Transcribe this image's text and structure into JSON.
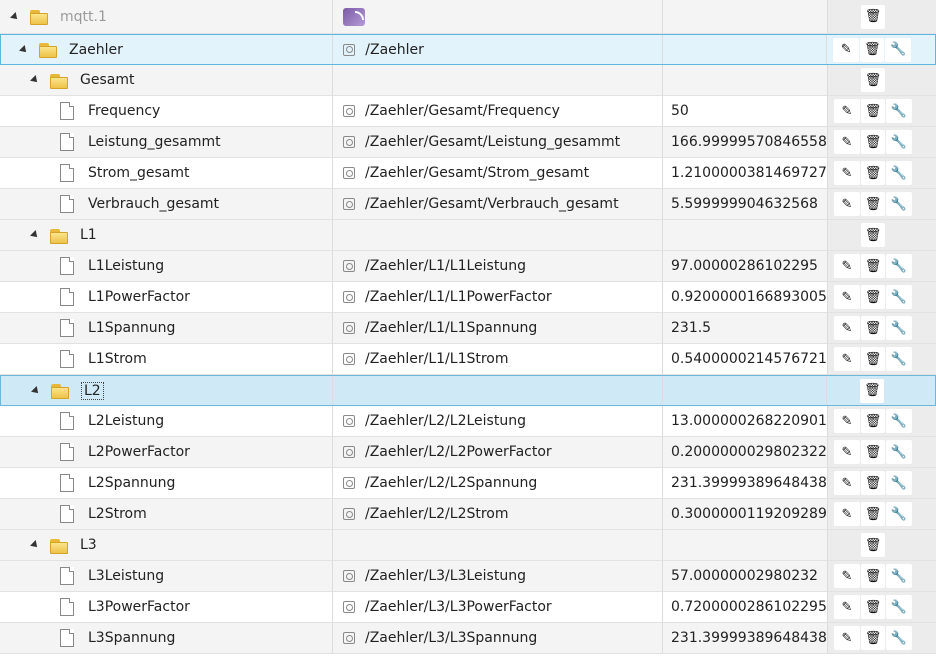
{
  "root": {
    "name": "mqtt.1"
  },
  "rows": [
    {
      "level": 1,
      "type": "folder",
      "name": "Zaehler",
      "topic": "/Zaehler",
      "value": "",
      "actions": [
        "edit",
        "delete",
        "wrench"
      ],
      "style": "sel-blue"
    },
    {
      "level": 2,
      "type": "folder",
      "name": "Gesamt",
      "topic": "",
      "value": "",
      "actions": [
        "delete"
      ],
      "style": "folder-row"
    },
    {
      "level": 3,
      "type": "state",
      "name": "Frequency",
      "topic": "/Zaehler/Gesamt/Frequency",
      "value": "50",
      "actions": [
        "edit",
        "delete",
        "wrench"
      ]
    },
    {
      "level": 3,
      "type": "state",
      "name": "Leistung_gesammt",
      "topic": "/Zaehler/Gesamt/Leistung_gesammt",
      "value": "166.99999570846558",
      "actions": [
        "edit",
        "delete",
        "wrench"
      ]
    },
    {
      "level": 3,
      "type": "state",
      "name": "Strom_gesamt",
      "topic": "/Zaehler/Gesamt/Strom_gesamt",
      "value": "1.2100000381469727",
      "actions": [
        "edit",
        "delete",
        "wrench"
      ]
    },
    {
      "level": 3,
      "type": "state",
      "name": "Verbrauch_gesamt",
      "topic": "/Zaehler/Gesamt/Verbrauch_gesamt",
      "value": "5.599999904632568",
      "actions": [
        "edit",
        "delete",
        "wrench"
      ]
    },
    {
      "level": 2,
      "type": "folder",
      "name": "L1",
      "topic": "",
      "value": "",
      "actions": [
        "delete"
      ],
      "style": "folder-row"
    },
    {
      "level": 3,
      "type": "state",
      "name": "L1Leistung",
      "topic": "/Zaehler/L1/L1Leistung",
      "value": "97.00000286102295",
      "actions": [
        "edit",
        "delete",
        "wrench"
      ]
    },
    {
      "level": 3,
      "type": "state",
      "name": "L1PowerFactor",
      "topic": "/Zaehler/L1/L1PowerFactor",
      "value": "0.9200000166893005",
      "actions": [
        "edit",
        "delete",
        "wrench"
      ]
    },
    {
      "level": 3,
      "type": "state",
      "name": "L1Spannung",
      "topic": "/Zaehler/L1/L1Spannung",
      "value": "231.5",
      "actions": [
        "edit",
        "delete",
        "wrench"
      ]
    },
    {
      "level": 3,
      "type": "state",
      "name": "L1Strom",
      "topic": "/Zaehler/L1/L1Strom",
      "value": "0.5400000214576721",
      "actions": [
        "edit",
        "delete",
        "wrench"
      ]
    },
    {
      "level": 2,
      "type": "folder",
      "name": "L2",
      "topic": "",
      "value": "",
      "actions": [
        "delete"
      ],
      "style": "sel-light"
    },
    {
      "level": 3,
      "type": "state",
      "name": "L2Leistung",
      "topic": "/Zaehler/L2/L2Leistung",
      "value": "13.000000268220901",
      "actions": [
        "edit",
        "delete",
        "wrench"
      ]
    },
    {
      "level": 3,
      "type": "state",
      "name": "L2PowerFactor",
      "topic": "/Zaehler/L2/L2PowerFactor",
      "value": "0.20000000298023224",
      "actions": [
        "edit",
        "delete",
        "wrench"
      ]
    },
    {
      "level": 3,
      "type": "state",
      "name": "L2Spannung",
      "topic": "/Zaehler/L2/L2Spannung",
      "value": "231.39999389648438",
      "actions": [
        "edit",
        "delete",
        "wrench"
      ]
    },
    {
      "level": 3,
      "type": "state",
      "name": "L2Strom",
      "topic": "/Zaehler/L2/L2Strom",
      "value": "0.30000001192092896",
      "actions": [
        "edit",
        "delete",
        "wrench"
      ]
    },
    {
      "level": 2,
      "type": "folder",
      "name": "L3",
      "topic": "",
      "value": "",
      "actions": [
        "delete"
      ],
      "style": "folder-row"
    },
    {
      "level": 3,
      "type": "state",
      "name": "L3Leistung",
      "topic": "/Zaehler/L3/L3Leistung",
      "value": "57.00000002980232",
      "actions": [
        "edit",
        "delete",
        "wrench"
      ]
    },
    {
      "level": 3,
      "type": "state",
      "name": "L3PowerFactor",
      "topic": "/Zaehler/L3/L3PowerFactor",
      "value": "0.7200000286102295",
      "actions": [
        "edit",
        "delete",
        "wrench"
      ]
    },
    {
      "level": 3,
      "type": "state",
      "name": "L3Spannung",
      "topic": "/Zaehler/L3/L3Spannung",
      "value": "231.39999389648438",
      "actions": [
        "edit",
        "delete",
        "wrench"
      ]
    }
  ],
  "icons": {
    "edit": "pencil-icon",
    "delete": "trash-icon",
    "wrench": "wrench-icon"
  },
  "colors": {
    "selected_border": "#5fb6dd",
    "selected_bg": "#e3f3fb",
    "folder": "#eec24a"
  }
}
